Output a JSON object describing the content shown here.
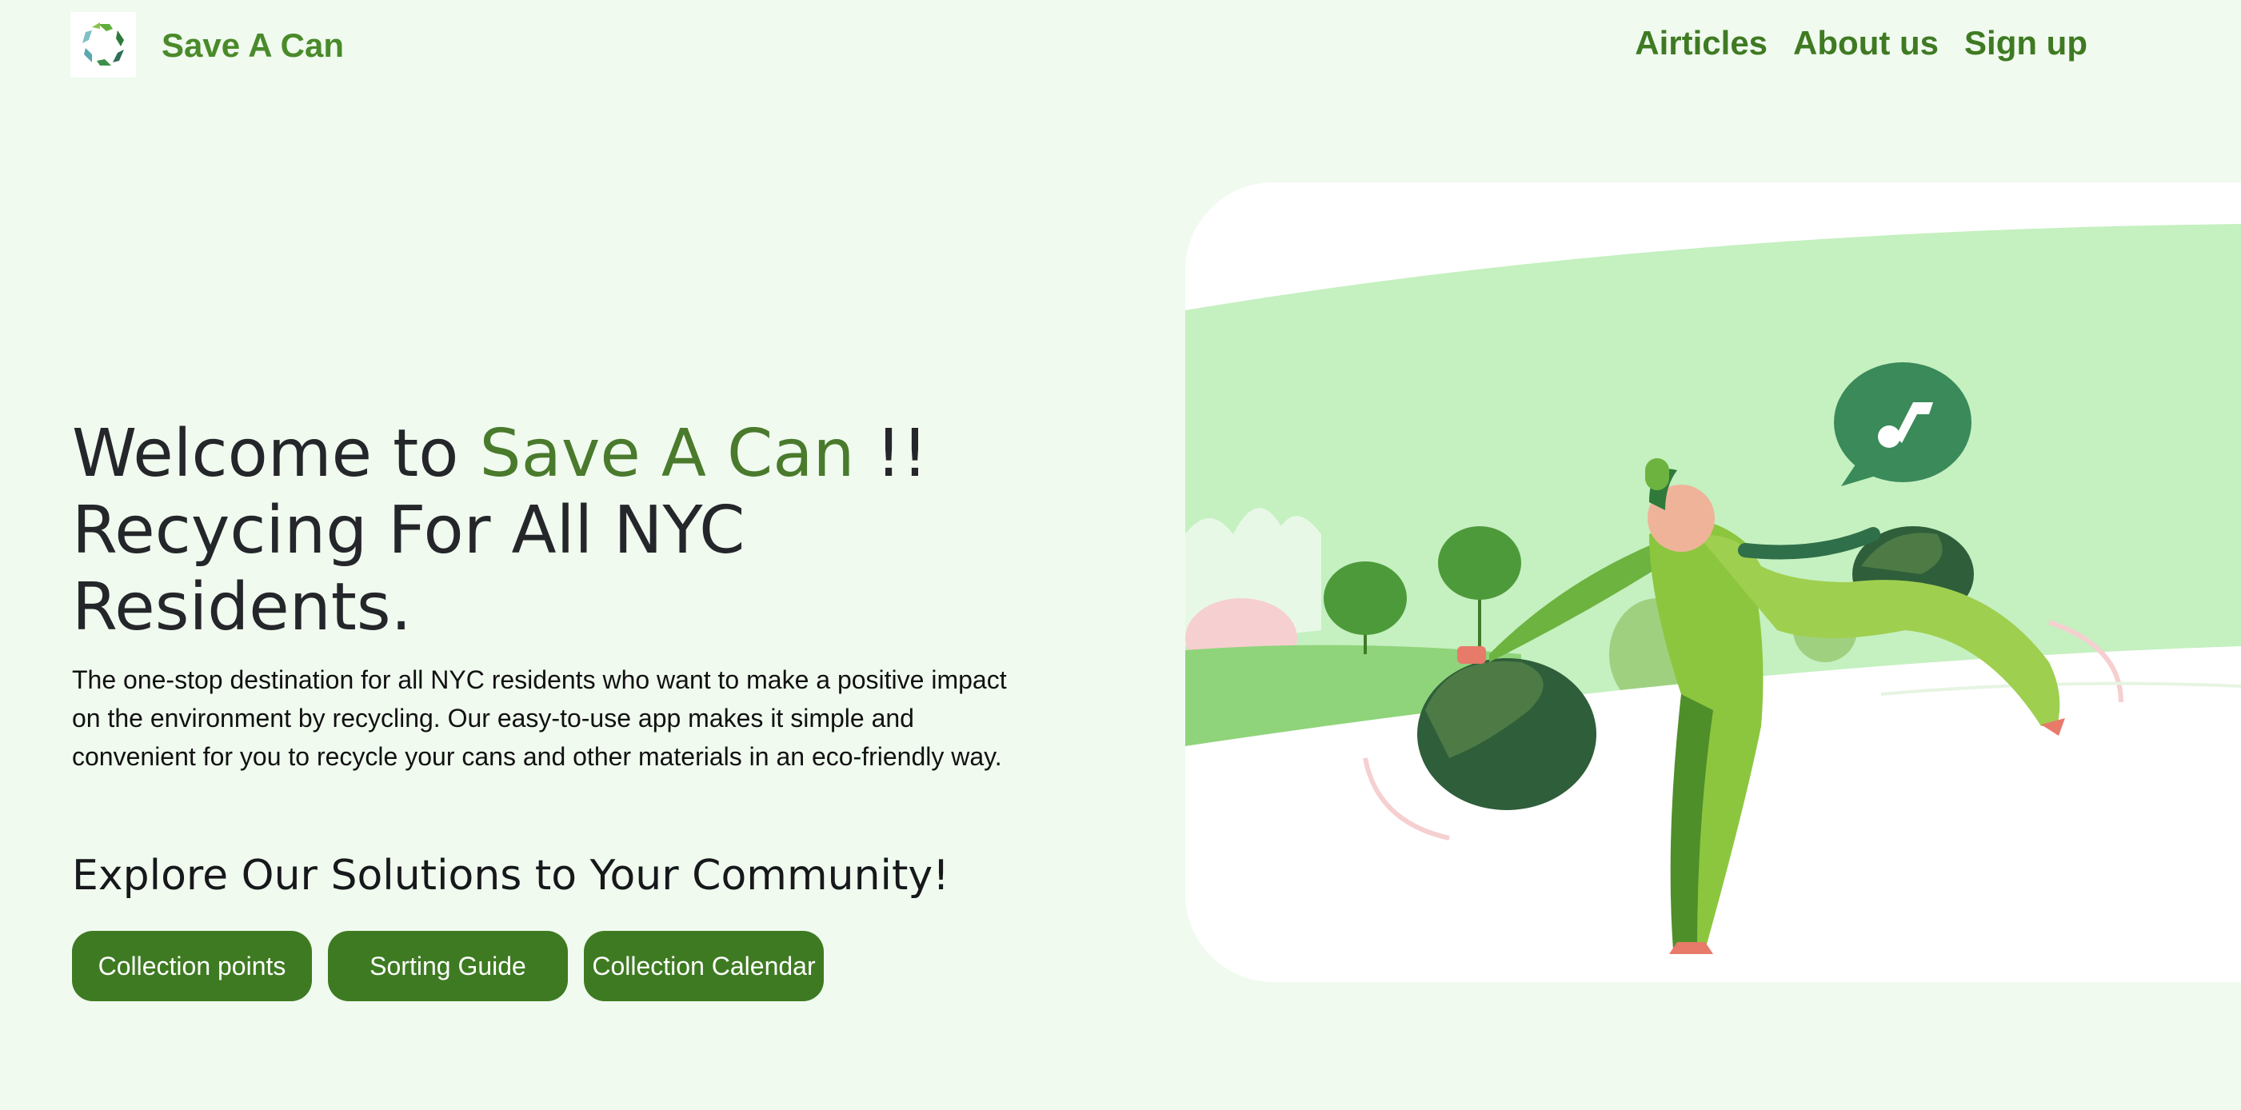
{
  "header": {
    "logo_icon": "recycle-logo-icon",
    "brand": "Save A Can",
    "nav": [
      "Airticles",
      "About us",
      "Sign up"
    ]
  },
  "hero": {
    "title_prefix": "Welcome to ",
    "title_accent": "Save A Can",
    "title_suffix": " !!",
    "title_line2": "Recycing For All NYC Residents.",
    "description": "The one-stop destination for all NYC residents who want to make a positive impact on the environment by recycling. Our easy-to-use app makes it simple and convenient for you to recycle your cans and other materials in an eco-friendly way.",
    "explore_title": "Explore Our Solutions to Your Community!",
    "buttons": [
      "Collection points",
      "Sorting Guide",
      "Collection Calendar"
    ],
    "illustration_icon": "person-recycling-illustration"
  },
  "colors": {
    "background": "#f0faef",
    "brand_green": "#4a8a2a",
    "button_green": "#3e7a22",
    "accent_title": "#4a7a2c"
  }
}
